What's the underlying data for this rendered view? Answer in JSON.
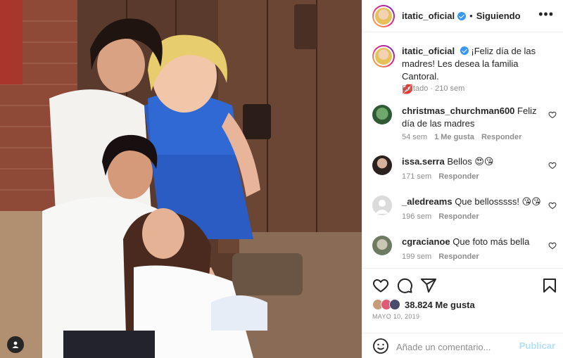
{
  "header": {
    "username": "itatic_oficial",
    "separator": "•",
    "follow_label": "Siguiendo",
    "more_glyph": "•••"
  },
  "caption": {
    "username": "itatic_oficial",
    "text": "¡Feliz día de las madres! Les desea la familia Cantoral.",
    "emoji": "💋",
    "meta": "Editado · 210 sem"
  },
  "comments": [
    {
      "username": "christmas_churchman600",
      "text": "Feliz día de las madres",
      "time": "54 sem",
      "likes": "1 Me gusta",
      "reply": "Responder"
    },
    {
      "username": "issa.serra",
      "text": "Bellos 😍😘",
      "time": "171 sem",
      "likes": "",
      "reply": "Responder"
    },
    {
      "username": "_aledreams",
      "text": "Que bellosssss! 😘😘",
      "time": "196 sem",
      "likes": "",
      "reply": "Responder"
    },
    {
      "username": "cgracianoe",
      "text": "Que foto más bella",
      "time": "199 sem",
      "likes": "",
      "reply": "Responder"
    }
  ],
  "likes": {
    "count": "38.824",
    "label": "Me gusta"
  },
  "date": "MAYO 10, 2019",
  "add_comment": {
    "placeholder": "Añade un comentario...",
    "publish_label": "Publicar"
  },
  "icons": {
    "like": "heart-icon",
    "comment": "comment-icon",
    "share": "share-icon",
    "save": "bookmark-icon",
    "emoji": "smiley-icon",
    "verified": "verified-badge-icon",
    "tag": "user-tag-icon"
  },
  "colors": {
    "verified": "#3897f0",
    "publish_disabled": "#b2dffc",
    "muted": "#8e8e8e",
    "text": "#262626"
  }
}
